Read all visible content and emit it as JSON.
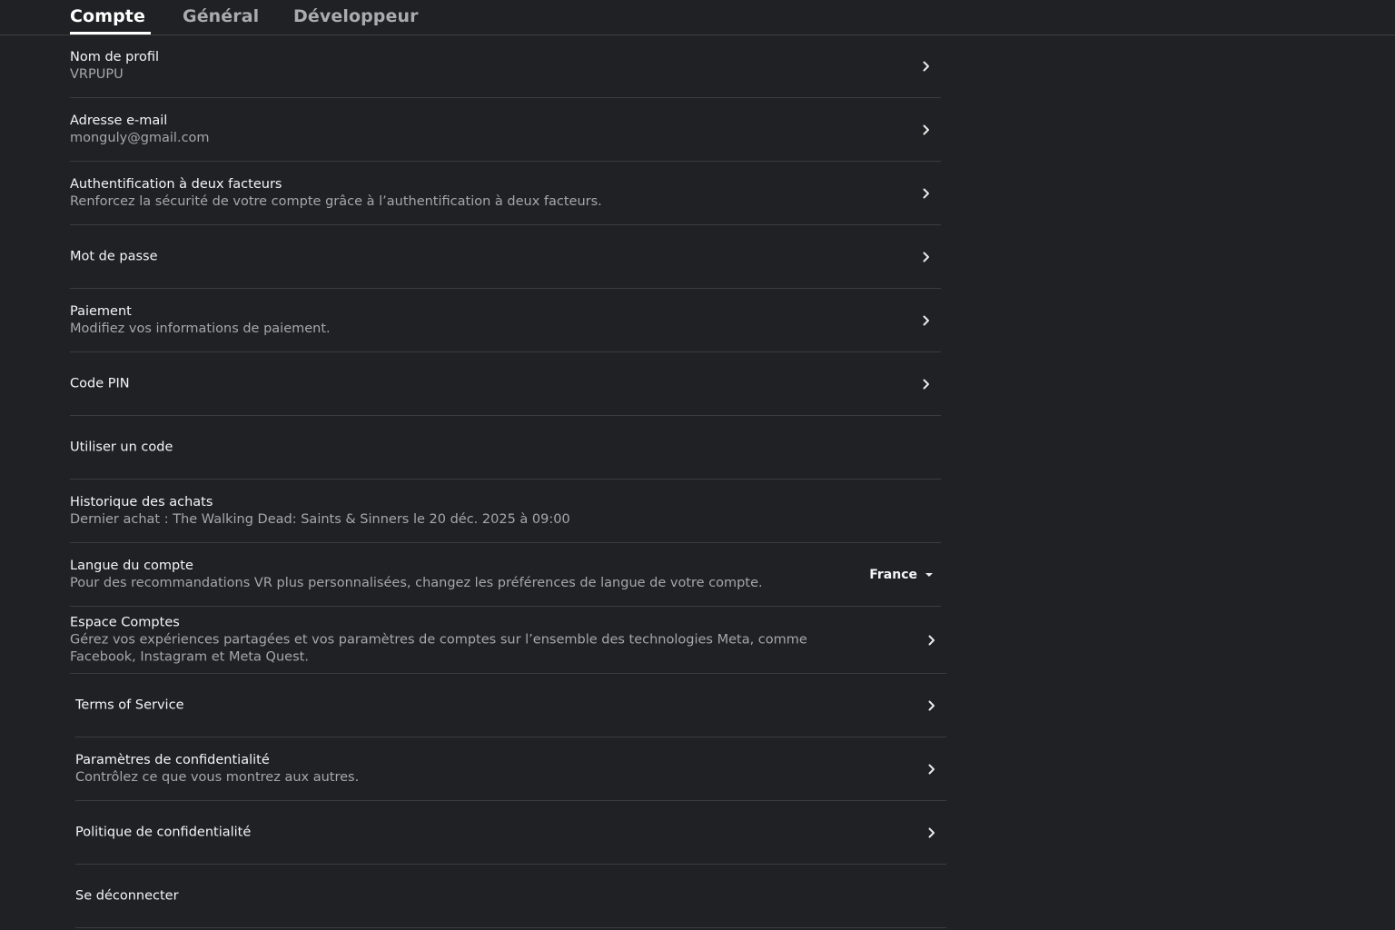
{
  "tabs": [
    {
      "label": "Compte",
      "active": true
    },
    {
      "label": "Général",
      "active": false
    },
    {
      "label": "Développeur",
      "active": false
    }
  ],
  "rows": {
    "profile_name": {
      "title": "Nom de profil",
      "subtitle": "VRPUPU"
    },
    "email": {
      "title": "Adresse e-mail",
      "subtitle": "monguly@gmail.com"
    },
    "two_factor": {
      "title": "Authentification à deux facteurs",
      "subtitle": "Renforcez la sécurité de votre compte grâce à l’authentification à deux facteurs."
    },
    "password": {
      "title": "Mot de passe"
    },
    "payment": {
      "title": "Paiement",
      "subtitle": "Modifiez vos informations de paiement."
    },
    "pin": {
      "title": "Code PIN"
    },
    "redeem_code": {
      "title": "Utiliser un code"
    },
    "purchase_history": {
      "title": "Historique des achats",
      "subtitle": "Dernier achat : The Walking Dead: Saints & Sinners le 20 déc. 2025 à 09:00"
    },
    "account_language": {
      "title": "Langue du compte",
      "subtitle": "Pour des recommandations VR plus personnalisées, changez les préférences de langue de votre compte.",
      "value": "France"
    },
    "accounts_center": {
      "title": "Espace Comptes",
      "subtitle": "Gérez vos expériences partagées et vos paramètres de comptes sur l’ensemble des technologies Meta, comme Facebook, Instagram et Meta Quest."
    },
    "terms": {
      "title": "Terms of Service"
    },
    "privacy_settings": {
      "title": "Paramètres de confidentialité",
      "subtitle": "Contrôlez ce que vous montrez aux autres."
    },
    "privacy_policy": {
      "title": "Politique de confidentialité"
    },
    "logout": {
      "title": "Se déconnecter"
    }
  },
  "icons": {
    "row_action": "chevron-right-icon",
    "dropdown": "caret-down-icon"
  },
  "colors": {
    "background": "#202124",
    "text_primary": "#f4f5f6",
    "text_secondary": "#a4a7ad",
    "divider": "#3a3c40",
    "tab_inactive": "#a9abb0"
  }
}
